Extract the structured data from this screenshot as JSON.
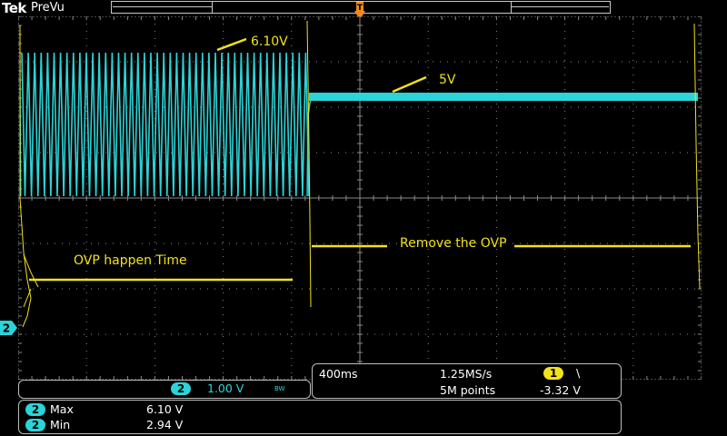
{
  "header": {
    "brand": "Tek",
    "mode": "PreVu",
    "trigger_marker_label": "T"
  },
  "annotations": {
    "peak_label": "6.10V",
    "regulated_label": "5V",
    "ovp_time_label": "OVP happen Time",
    "remove_label": "Remove the OVP"
  },
  "channel": {
    "number": "2",
    "scale": "1.00 V",
    "bw_label": "BW",
    "ground_marker": "2"
  },
  "acquisition": {
    "timebase": "400ms",
    "sample_rate": "1.25MS/s",
    "record_length": "5M points",
    "trigger_source": "1",
    "trigger_slope": "\\",
    "trigger_level": "-3.32 V"
  },
  "measurements": [
    {
      "source": "2",
      "name": "Max",
      "value": "6.10 V"
    },
    {
      "source": "2",
      "name": "Min",
      "value": "2.94 V"
    }
  ],
  "colors": {
    "ch2_trace": "#2ad4d8",
    "annotation": "#f2e21a",
    "grid": "#8a8a8a",
    "trigger_marker": "#f08a1c"
  }
}
